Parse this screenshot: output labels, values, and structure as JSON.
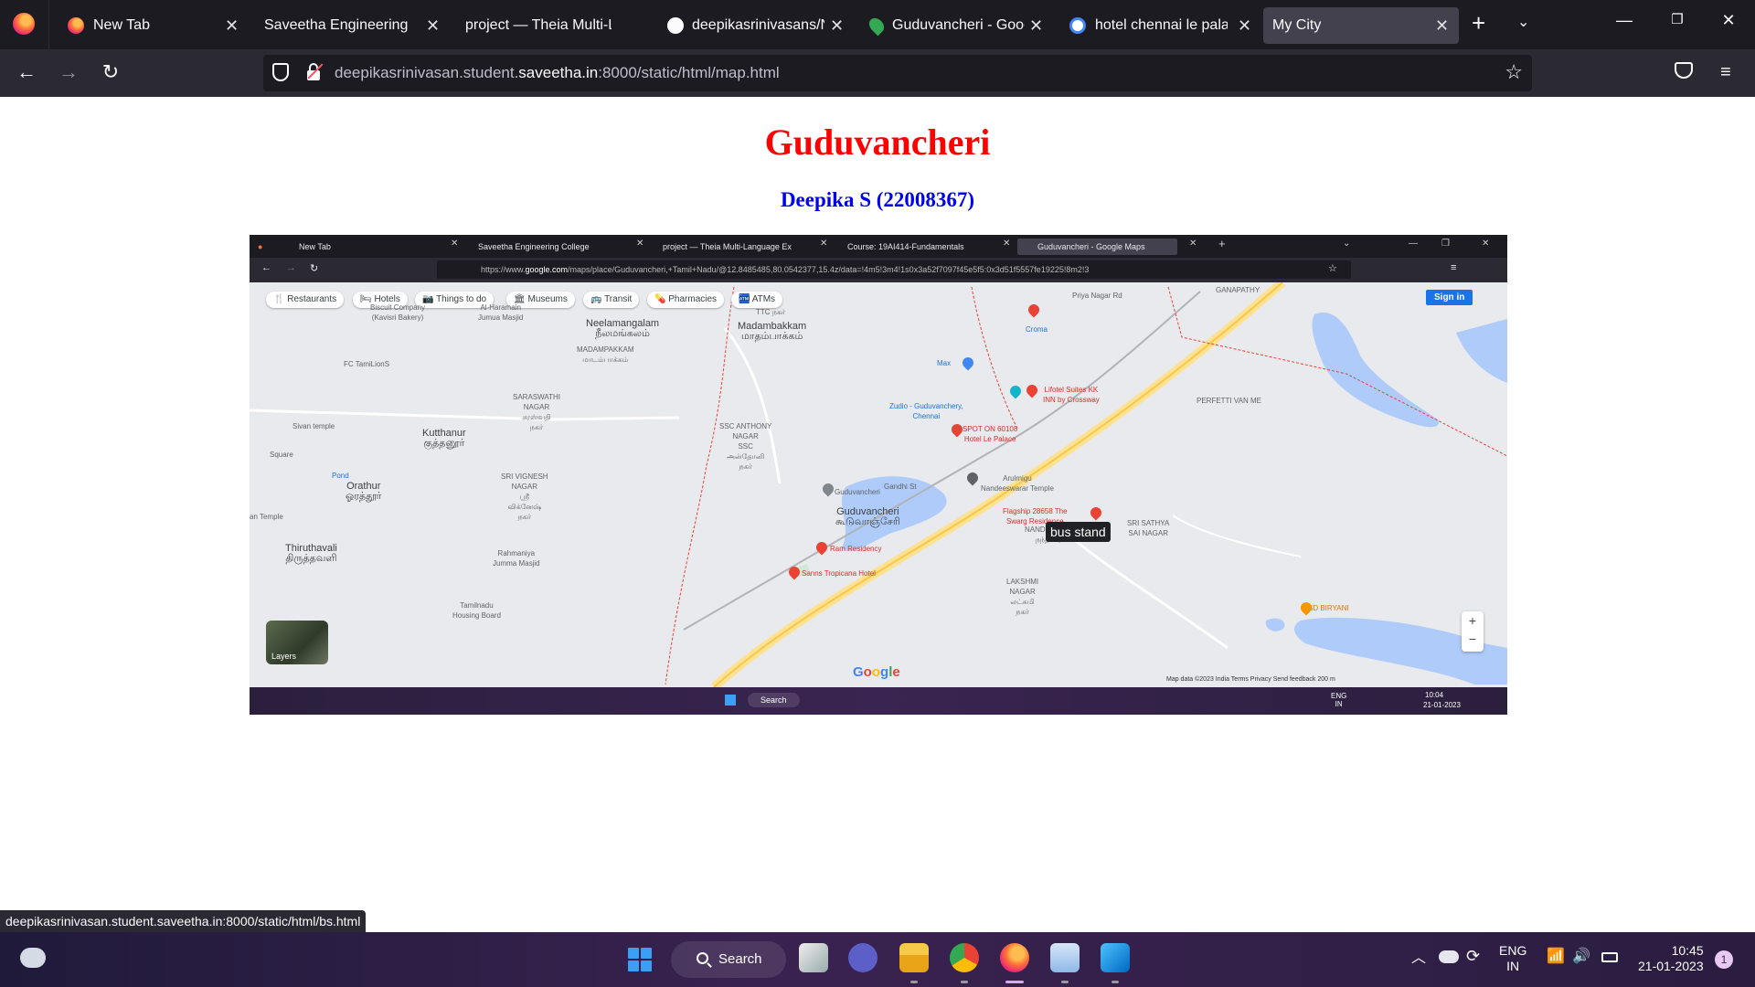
{
  "browser": {
    "tabs": [
      {
        "title": "New Tab",
        "icon": "firefox-icon"
      },
      {
        "title": "Saveetha Engineering Colle",
        "icon": "none"
      },
      {
        "title": "project — Theia Multi-Lang",
        "icon": "none"
      },
      {
        "title": "deepikasrinivasans/Ne",
        "icon": "github-icon"
      },
      {
        "title": "Guduvancheri - Googl",
        "icon": "google-maps-icon"
      },
      {
        "title": "hotel chennai le palac",
        "icon": "google-icon"
      },
      {
        "title": "My City",
        "icon": "none"
      }
    ],
    "url_prefix": "deepikasrinivasan.student.",
    "url_host": "saveetha.in",
    "url_suffix": ":8000/static/html/map.html"
  },
  "page": {
    "title": "Guduvancheri",
    "subtitle": "Deepika S (22008367)"
  },
  "screenshot": {
    "tabs": [
      "New Tab",
      "Saveetha Engineering College",
      "project — Theia Multi-Language Ex",
      "Course: 19AI414-Fundamentals",
      "Guduvancheri - Google Maps"
    ],
    "url_prefix": "https://www.",
    "url_host": "google.com",
    "url_rest": "/maps/place/Guduvancheri,+Tamil+Nadu/@12.8485485,80.0542377,15.4z/data=!4m5!3m4!1s0x3a52f7097f45e5f5:0x3d51f5557fe19225!8m2!3",
    "chips": [
      "Restaurants",
      "Hotels",
      "Things to do",
      "Museums",
      "Transit",
      "Pharmacies",
      "ATMs"
    ],
    "sign_in": "Sign in",
    "layers": "Layers",
    "tooltip": "bus stand",
    "google": "Google",
    "footer": "Map data ©2023     India     Terms     Privacy     Send feedback     200 m",
    "labels": {
      "neelamangalam": "Neelamangalam",
      "neelamangalam_ta": "நீலமங்கலம்",
      "madampakkam_small": "MADAMPAKKAM\nமாடம்பாக்கம்",
      "madambakkam": "Madambakkam",
      "madambakkam_ta": "மாதம்பாக்கம்",
      "biscuit": "Biscuit Company\n(Kavisri Bakery)",
      "masjid": "Al-Haramain\nJumua Masjid",
      "fc": "FC TamiLionS",
      "saraswathi": "SARASWATHI\nNAGAR\nசரஸ்வதி\nநகர்",
      "sivan": "Sivan temple",
      "kutthanur": "Kutthanur",
      "kutthanur_ta": "குத்தனூர்",
      "square": "Square",
      "pond": "Pond",
      "orathur": "Orathur",
      "orathur_ta": "ஓரத்தூர்",
      "antemple": "an Temple",
      "thiruthavali": "Thiruthavali",
      "thiruthavali_ta": "திருத்தவளி",
      "vignesh": "SRI VIGNESH\nNAGAR\nஸ்ரீ\nவிக்னேஷ்\nநகர்",
      "rahmaniya": "Rahmaniya\nJumma Masjid",
      "tamilnadu": "Tamilnadu\nHousing Board",
      "ssc": "SSC ANTHONY\nNAGAR\nSSC\nஅன்தோனி\nநகர்",
      "guduvancheri_pin": "Guduvancheri",
      "guduvancheri": "Guduvancheri",
      "guduvancheri_ta": "கூடுவாஞ்சேரி",
      "ram": "Ram Residency",
      "sanns": "Sanns Tropicana Hotel",
      "croma": "Croma",
      "max": "Max",
      "zudio": "Zudio - Guduvanchery,\nChennai",
      "lifotel": "Lifotel Suites KK\nINN by Crossway",
      "spot": "SPOT ON 60108\nHotel Le Palace",
      "arulmigu": "Arulmigu\nNandeeswarar Temple",
      "flagship": "Flagship 28658 The\nSwarg Residence",
      "nandhivaram": "NANDHIVARAM\nநந்திவரம்",
      "satya": "SRI SATHYA\nSAI NAGAR",
      "lakshmi": "LAKSHMI\nNAGAR\nலட்சுமி\nநகர்",
      "perfetti": "PERFETTI VAN ME",
      "ganapathy": "GANAPATHY",
      "priya": "Priya Nagar Rd",
      "gandhi": "Gandhi St",
      "ttc": "TTC நகர்",
      "biryani": "SD BIRYANI"
    },
    "taskbar": {
      "search": "Search",
      "lang": "ENG\nIN",
      "time": "10:04",
      "date": "21-01-2023"
    }
  },
  "status_link": "deepikasrinivasan.student.saveetha.in:8000/static/html/bs.html",
  "taskbar": {
    "search": "Search",
    "lang_top": "ENG",
    "lang_bottom": "IN",
    "time": "10:45",
    "date": "21-01-2023",
    "notifications": "1"
  }
}
